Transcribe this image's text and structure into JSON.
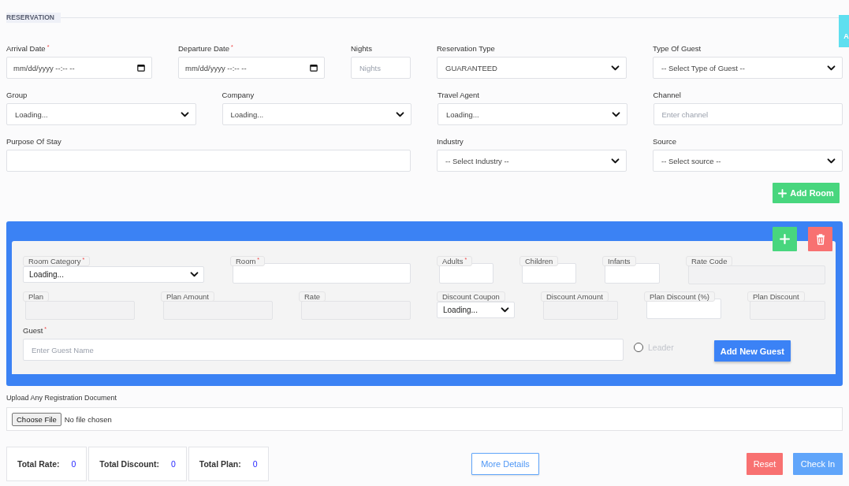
{
  "section_title": "RESERVATION",
  "side_tab": {
    "label": "A"
  },
  "form_rows": [
    [
      {
        "label": "Arrival Date",
        "required_mark": "*",
        "kind": "date",
        "value": "mm/dd/yyyy --:-- --"
      },
      {
        "label": "Departure Date",
        "required_mark": "*",
        "kind": "date",
        "value": "mm/dd/yyyy --:-- --"
      },
      {
        "label": "Nights",
        "kind": "text",
        "placeholder": "Nights"
      },
      {
        "label": "Reservation Type",
        "kind": "select",
        "value": "GUARANTEED"
      },
      {
        "label": "Type Of Guest",
        "kind": "select",
        "value": "-- Select Type of Guest --"
      }
    ],
    [
      {
        "label": "Group",
        "kind": "select",
        "value": "Loading..."
      },
      {
        "label": "Company",
        "kind": "select",
        "value": "Loading..."
      },
      {
        "label": "Travel Agent",
        "kind": "select",
        "value": "Loading..."
      },
      {
        "label": "Channel",
        "kind": "text",
        "placeholder": "Enter channel"
      }
    ],
    [
      {
        "label": "Purpose Of Stay",
        "kind": "text"
      },
      {
        "label": "Industry",
        "kind": "select",
        "value": "-- Select Industry --"
      },
      {
        "label": "Source",
        "kind": "select",
        "value": "-- Select source --"
      }
    ]
  ],
  "add_room_button": {
    "label": "Add Room"
  },
  "room": {
    "field_rows": [
      [
        {
          "label": "Room Category",
          "required_mark": "*",
          "kind": "select",
          "value": "Loading..."
        },
        {
          "label": "Room",
          "required_mark": "*",
          "kind": "text"
        },
        {
          "label": "Adults",
          "required_mark": "*",
          "kind": "text"
        },
        {
          "label": "Children",
          "kind": "text"
        },
        {
          "label": "Infants",
          "kind": "text"
        },
        {
          "label": "Rate Code",
          "kind": "readonly"
        }
      ],
      [
        {
          "label": "Plan",
          "kind": "readonly"
        },
        {
          "label": "Plan Amount",
          "kind": "readonly"
        },
        {
          "label": "Rate",
          "kind": "readonly"
        },
        {
          "label": "Discount Coupon",
          "kind": "select",
          "value": "Loading..."
        },
        {
          "label": "Discount Amount",
          "kind": "readonly"
        },
        {
          "label": "Plan Discount (%)",
          "kind": "text"
        },
        {
          "label": "Plan Discount",
          "kind": "readonly"
        }
      ]
    ],
    "guest": {
      "label": "Guest",
      "required_mark": "*",
      "kind": "text",
      "placeholder": "Enter Guest Name"
    },
    "leader": {
      "label": "Leader",
      "selected": false
    },
    "add_guest_button": {
      "label": "Add New Guest"
    }
  },
  "upload": {
    "label": "Upload Any Registration Document",
    "button": "Choose File",
    "status": "No file chosen"
  },
  "totals": [
    {
      "label": "Total Rate:",
      "value": "0"
    },
    {
      "label": "Total Discount:",
      "value": "0"
    },
    {
      "label": "Total Plan:",
      "value": "0"
    }
  ],
  "more_details_button": {
    "label": "More Details"
  },
  "reset_button": {
    "label": "Reset"
  },
  "check_in_button": {
    "label": "Check In"
  }
}
